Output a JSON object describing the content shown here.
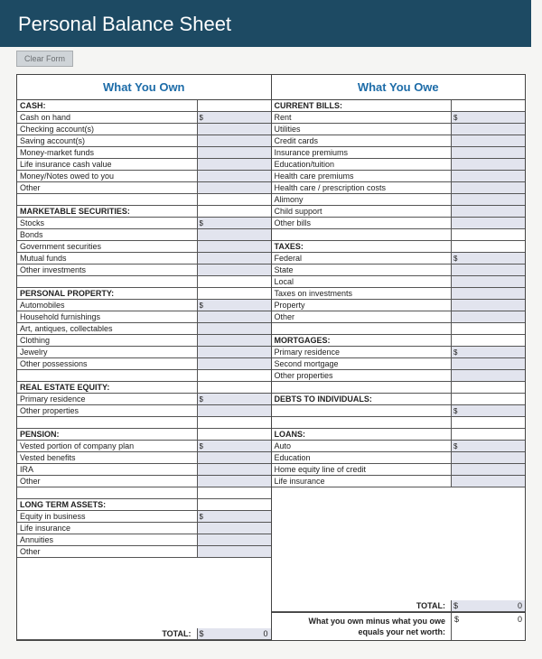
{
  "title": "Personal Balance Sheet",
  "clear_button": "Clear Form",
  "col_own": {
    "header": "What You Own",
    "groups": [
      {
        "title": "CASH:",
        "items": [
          "Cash on hand",
          "Checking account(s)",
          "Saving account(s)",
          "Money-market funds",
          "Life insurance cash value",
          "Money/Notes owed to you",
          "Other"
        ]
      },
      {
        "title": "MARKETABLE SECURITIES:",
        "items": [
          "Stocks",
          "Bonds",
          "Government securities",
          "Mutual funds",
          "Other investments"
        ]
      },
      {
        "title": "PERSONAL PROPERTY:",
        "items": [
          "Automobiles",
          "Household furnishings",
          "Art, antiques, collectables",
          "Clothing",
          "Jewelry",
          "Other possessions"
        ]
      },
      {
        "title": "REAL ESTATE EQUITY:",
        "items": [
          "Primary residence",
          "Other properties"
        ]
      },
      {
        "title": "PENSION:",
        "items": [
          "Vested portion of company plan",
          "Vested benefits",
          "IRA",
          "Other"
        ]
      },
      {
        "title": "LONG TERM ASSETS:",
        "items": [
          "Equity in business",
          "Life insurance",
          "Annuities",
          "Other"
        ]
      }
    ],
    "total_label": "TOTAL:",
    "total_prefix": "$",
    "total_value": "0"
  },
  "col_owe": {
    "header": "What You Owe",
    "groups": [
      {
        "title": "CURRENT BILLS:",
        "items": [
          "Rent",
          "Utilities",
          "Credit cards",
          "Insurance premiums",
          "Education/tuition",
          "Health care premiums",
          "Health care / prescription costs",
          "Alimony",
          "Child support",
          "Other bills"
        ]
      },
      {
        "title": "TAXES:",
        "items": [
          "Federal",
          "State",
          "Local",
          "Taxes on investments",
          "Property",
          "Other"
        ]
      },
      {
        "title": "MORTGAGES:",
        "items": [
          "Primary residence",
          "Second mortgage",
          "Other properties"
        ]
      },
      {
        "title": "DEBTS TO INDIVIDUALS:",
        "items": [
          ""
        ]
      },
      {
        "title": "LOANS:",
        "items": [
          "Auto",
          "Education",
          "Home equity line of credit",
          "Life insurance"
        ]
      }
    ],
    "total_label": "TOTAL:",
    "total_prefix": "$",
    "total_value": "0",
    "networth_label_line1": "What you own minus what you owe",
    "networth_label_line2": "equals your net worth:",
    "networth_prefix": "$",
    "networth_value": "0"
  }
}
